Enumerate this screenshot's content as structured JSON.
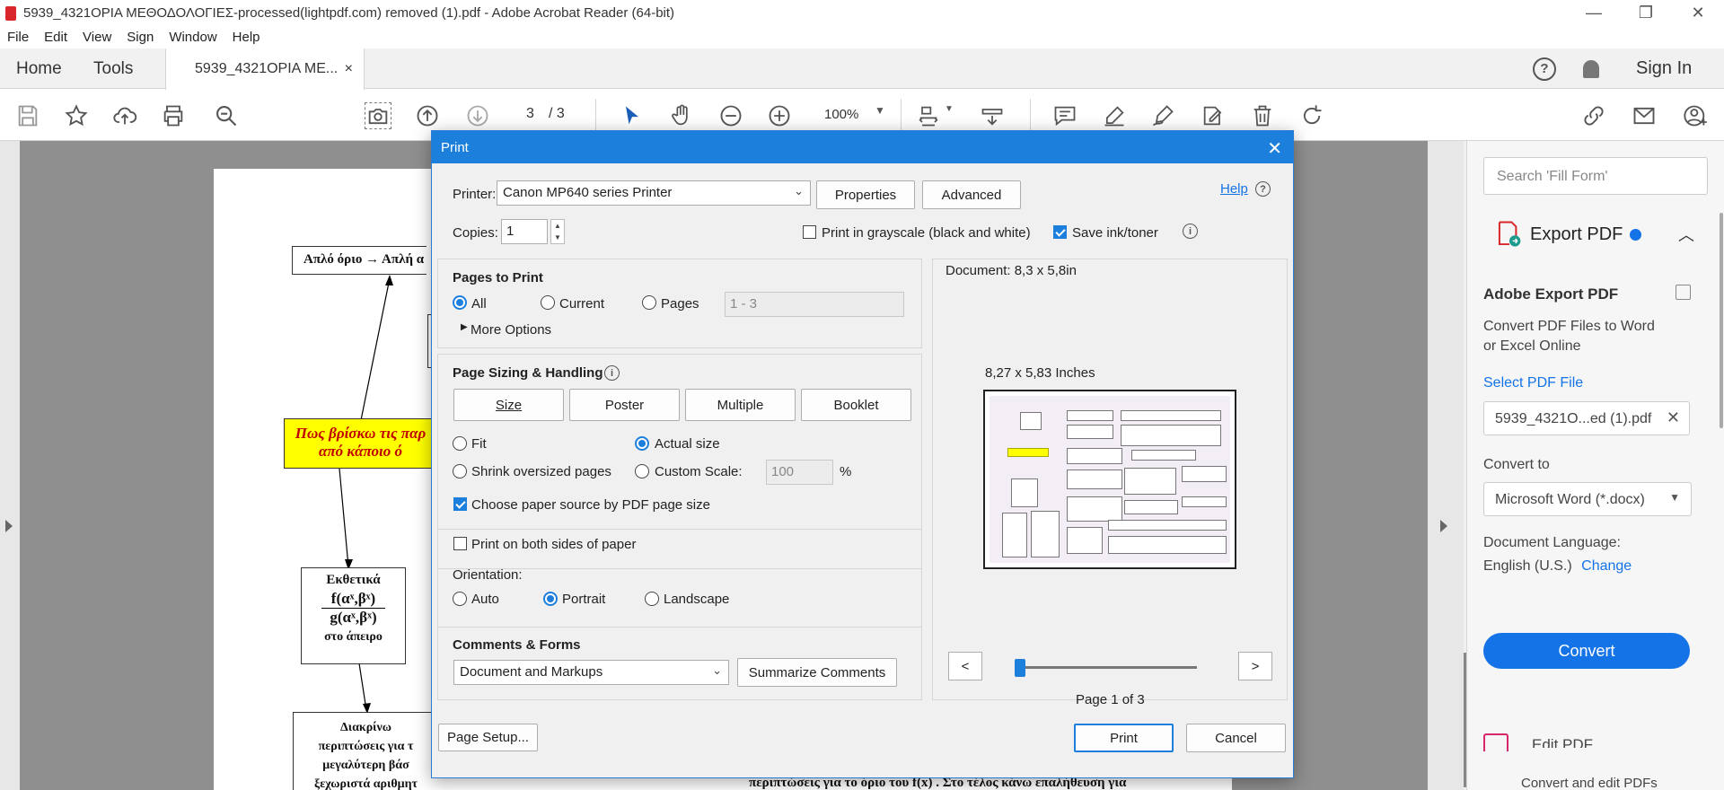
{
  "window": {
    "title": "5939_4321ΟΡΙΑ ΜΕΘΟΔΟΛΟΓΙΕΣ-processed(lightpdf.com)  removed (1).pdf - Adobe Acrobat Reader (64-bit)",
    "minimize": "—",
    "restore": "❐",
    "close": "✕"
  },
  "menu": [
    "File",
    "Edit",
    "View",
    "Sign",
    "Window",
    "Help"
  ],
  "tabs": {
    "home": "Home",
    "tools": "Tools",
    "document": "5939_4321ΟΡΙΑ ΜΕ...",
    "close": "×"
  },
  "header_right": {
    "help": "?",
    "sign_in": "Sign In"
  },
  "toolbar": {
    "current_page": "3",
    "total_pages": "/ 3",
    "zoom": "100%"
  },
  "document_page": {
    "top_box": "Απλό όριο → Απλή α",
    "yellow_line1": "Πως βρίσκω τις παρ",
    "yellow_line2": "από κάποιο ό",
    "exp_title": "Εκθετικά",
    "exp_num": "f(αˣ,βˣ)",
    "exp_den": "g(αˣ,βˣ)",
    "exp_footer": "στο άπειρο",
    "split_l1": "Διακρίνω",
    "split_l2": "περιπτώσεις για τ",
    "split_l3": "μεγαλύτερη βάσ",
    "split_l4": "ξεχωριστά αριθμητ",
    "bottom_text": "περιπτώσεις για το όριο του f(x) . Στο τέλος κάνω επαλήθευση για"
  },
  "right_pane": {
    "search_placeholder": "Search 'Fill Form'",
    "export_header": "Export PDF",
    "title": "Adobe Export PDF",
    "desc_line1": "Convert PDF Files to Word",
    "desc_line2": "or Excel Online",
    "select_label": "Select PDF File",
    "file_name": "5939_4321O...ed (1).pdf",
    "convert_to_label": "Convert to",
    "convert_to_value": "Microsoft Word (*.docx)",
    "doc_lang_label": "Document Language:",
    "doc_lang_value": "English (U.S.)",
    "change_link": "Change",
    "convert_button": "Convert",
    "edit_pdf": "Edit PDF",
    "edit_desc": "Convert and edit PDFs"
  },
  "print_dialog": {
    "title": "Print",
    "close": "✕",
    "printer_label": "Printer:",
    "printer_value": "Canon MP640 series Printer",
    "properties": "Properties",
    "advanced": "Advanced",
    "help": "Help",
    "copies_label": "Copies:",
    "copies_value": "1",
    "grayscale_label": "Print in grayscale (black and white)",
    "grayscale_checked": false,
    "save_ink_label": "Save ink/toner",
    "save_ink_checked": true,
    "pages_to_print": {
      "heading": "Pages to Print",
      "all": "All",
      "current": "Current",
      "pages": "Pages",
      "pages_range": "1 - 3",
      "selected": "All",
      "more_options": "More Options"
    },
    "sizing": {
      "heading": "Page Sizing & Handling",
      "size": "Size",
      "poster": "Poster",
      "multiple": "Multiple",
      "booklet": "Booklet",
      "fit": "Fit",
      "actual_size": "Actual size",
      "shrink": "Shrink oversized pages",
      "custom_scale": "Custom Scale:",
      "scale_value": "100",
      "percent": "%",
      "selected": "Actual size",
      "paper_source_label": "Choose paper source by PDF page size",
      "paper_source_checked": true
    },
    "both_sides_label": "Print on both sides of paper",
    "both_sides_checked": false,
    "orientation": {
      "label": "Orientation:",
      "auto": "Auto",
      "portrait": "Portrait",
      "landscape": "Landscape",
      "selected": "Portrait"
    },
    "comments_forms": {
      "heading": "Comments & Forms",
      "value": "Document and Markups",
      "summarize": "Summarize Comments"
    },
    "preview": {
      "document_size": "Document: 8,3 x 5,8in",
      "paper_size": "8,27 x 5,83 Inches",
      "prev": "<",
      "next": ">",
      "page_of": "Page 1 of 3"
    },
    "page_setup": "Page Setup...",
    "print": "Print",
    "cancel": "Cancel"
  },
  "colors": {
    "accent": "#1c7fdc",
    "link": "#1473e6",
    "yellow_box": "#ffff00",
    "yellow_text": "#c00000"
  }
}
